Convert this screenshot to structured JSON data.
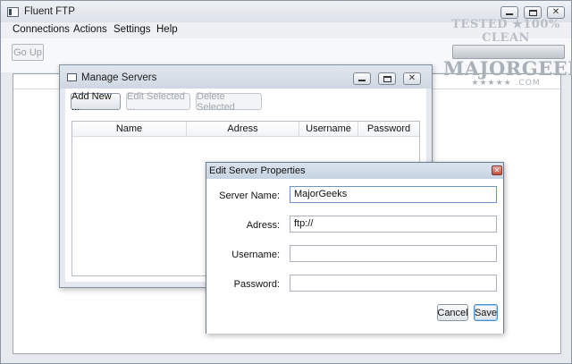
{
  "window": {
    "title": "Fluent FTP",
    "controls": {
      "minimize": "–",
      "maximize": "□",
      "close": "✕"
    }
  },
  "menu": [
    "Connections",
    "Actions",
    "Settings",
    "Help"
  ],
  "toolbar": {
    "go_up_label": "Go Up"
  },
  "watermark": {
    "line1": "TESTED ★100% CLEAN",
    "line2": "MAJORGEEKS",
    "line3": "★★★★★ .COM"
  },
  "manage_servers": {
    "title": "Manage Servers",
    "buttons": {
      "add_new": "Add New ...",
      "edit_selected": "Edit Selected ...",
      "delete_selected": "Delete Selected"
    },
    "columns": [
      "Name",
      "Adress",
      "Username",
      "Password"
    ]
  },
  "edit_props": {
    "title": "Edit Server Properties",
    "close_glyph": "✕",
    "fields": {
      "server_name": {
        "label": "Server Name:",
        "value": "MajorGeeks"
      },
      "address": {
        "label": "Adress:",
        "value": "ftp://"
      },
      "username": {
        "label": "Username:",
        "value": ""
      },
      "password": {
        "label": "Password:",
        "value": ""
      }
    },
    "cancel_label": "Cancel",
    "save_label": "Save"
  },
  "colors": {
    "accent": "#4b8ec9",
    "close_red": "#c8503c"
  }
}
